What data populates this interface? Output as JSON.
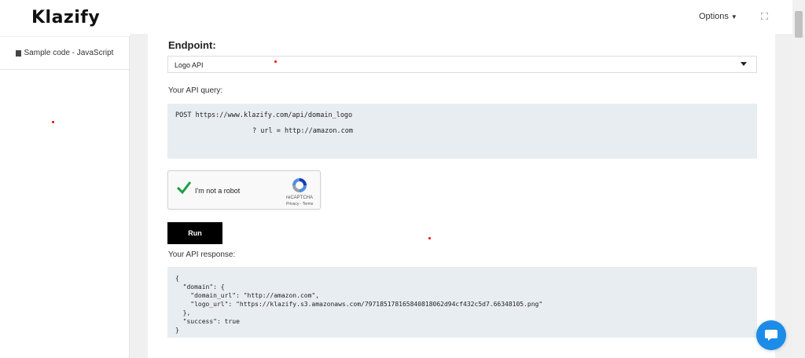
{
  "header": {
    "logo": "Klazify",
    "options_label": "Options"
  },
  "sidebar": {
    "items": [
      {
        "label": "Sample code - JavaScript"
      }
    ]
  },
  "endpoint": {
    "label": "Endpoint:",
    "selected": "Logo API"
  },
  "query": {
    "label": "Your API query:",
    "line1": "POST https://www.klazify.com/api/domain_logo",
    "line2": "? url = http://amazon.com"
  },
  "captcha": {
    "label": "I'm not a robot",
    "brand": "reCAPTCHA",
    "links": "Privacy - Terms"
  },
  "run_button": "Run",
  "response": {
    "label": "Your API response:",
    "lines": [
      "{",
      "  \"domain\": {",
      "    \"domain_url\": \"http://amazon.com\",",
      "    \"logo_url\": \"https://klazify.s3.amazonaws.com/797185178165840818062d94cf432c5d7.66348105.png\"",
      "  },",
      "  \"success\": true",
      "}"
    ]
  },
  "colors": {
    "accent_dark": "#000000",
    "code_bg": "#e8edf2",
    "chat_button": "#1c8ce8",
    "check_green": "#1a9f43"
  },
  "icons": [
    "chevron-down-icon",
    "fullscreen-icon",
    "document-icon",
    "checkmark-icon",
    "recaptcha-logo-icon",
    "chat-icon"
  ]
}
